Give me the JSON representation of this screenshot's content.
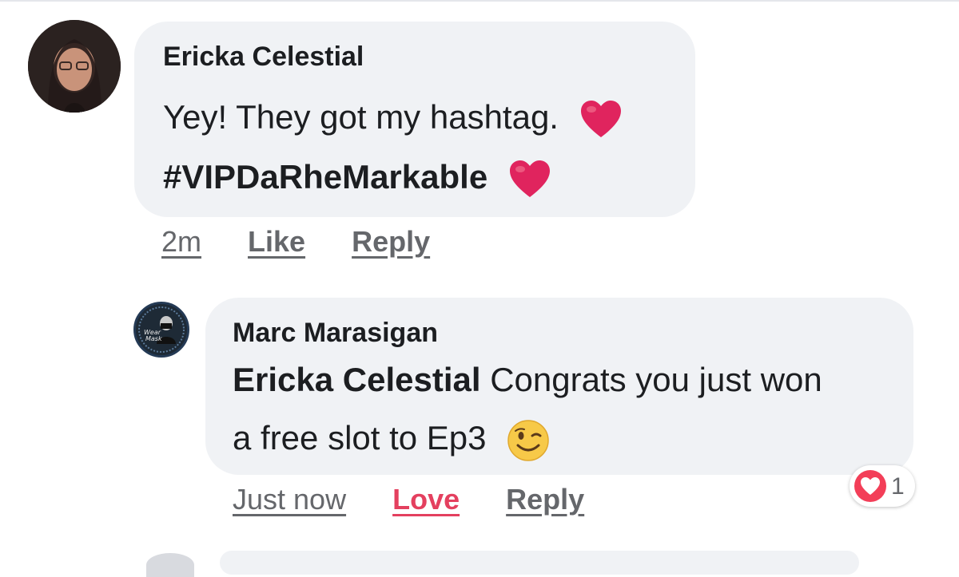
{
  "comments": [
    {
      "author": "Ericka Celestial",
      "line1": "Yey! They got my hashtag.",
      "line2": "#VIPDaRheMarkable",
      "time": "2m",
      "like": "Like",
      "reply": "Reply"
    }
  ],
  "reply_comment": {
    "author": "Marc Marasigan",
    "mention": "Ericka Celestial",
    "line1_rest": " Congrats you just won",
    "line2": "a free slot to Ep3",
    "time": "Just now",
    "love": "Love",
    "reply": "Reply",
    "reaction_count": "1",
    "avatar_text": "Wear a Mask"
  },
  "colors": {
    "bubble": "#f0f2f5",
    "love": "#e4405f",
    "heart": "#e0245e",
    "meta": "#65676b"
  }
}
